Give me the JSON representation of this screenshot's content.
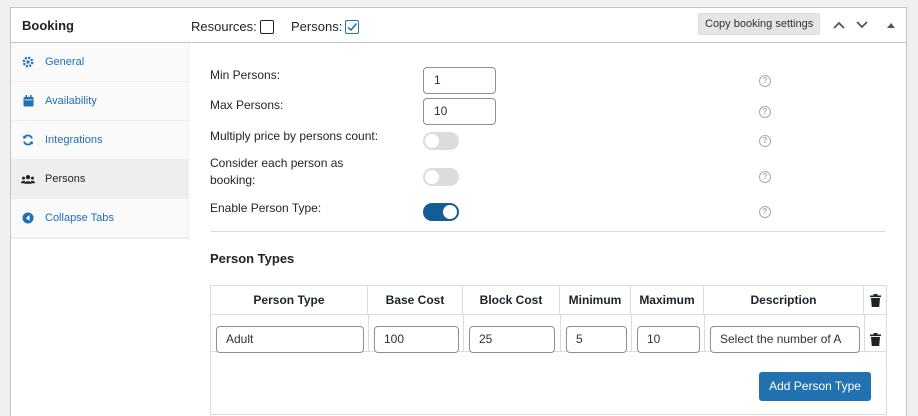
{
  "header": {
    "title": "Booking",
    "resources_label": "Resources:",
    "resources_checked": false,
    "persons_label": "Persons:",
    "persons_checked": true,
    "copy_button": "Copy booking settings"
  },
  "sidebar": {
    "items": [
      {
        "label": "General",
        "icon": "gear-icon",
        "active": false
      },
      {
        "label": "Availability",
        "icon": "calendar-icon",
        "active": false
      },
      {
        "label": "Integrations",
        "icon": "sync-icon",
        "active": false
      },
      {
        "label": "Persons",
        "icon": "users-icon",
        "active": true
      },
      {
        "label": "Collapse Tabs",
        "icon": "collapse-icon",
        "active": false
      }
    ]
  },
  "form": {
    "min_persons": {
      "label": "Min Persons:",
      "value": "1"
    },
    "max_persons": {
      "label": "Max Persons:",
      "value": "10"
    },
    "multiply_price": {
      "label": "Multiply price by persons count:",
      "enabled": false
    },
    "each_person_booking": {
      "label": "Consider each person as booking:",
      "enabled": false
    },
    "enable_person_type": {
      "label": "Enable Person Type:",
      "enabled": true
    }
  },
  "person_types": {
    "title": "Person Types",
    "columns": [
      "Person Type",
      "Base Cost",
      "Block Cost",
      "Minimum",
      "Maximum",
      "Description"
    ],
    "rows": [
      {
        "type": "Adult",
        "base_cost": "100",
        "block_cost": "25",
        "minimum": "5",
        "maximum": "10",
        "description": "Select the number of A"
      }
    ],
    "add_button": "Add Person Type"
  },
  "colors": {
    "accent": "#2271b1",
    "toggle_on": "#135e96",
    "toggle_off": "#dcdcde",
    "active_tab_bg": "#eeeeee"
  }
}
